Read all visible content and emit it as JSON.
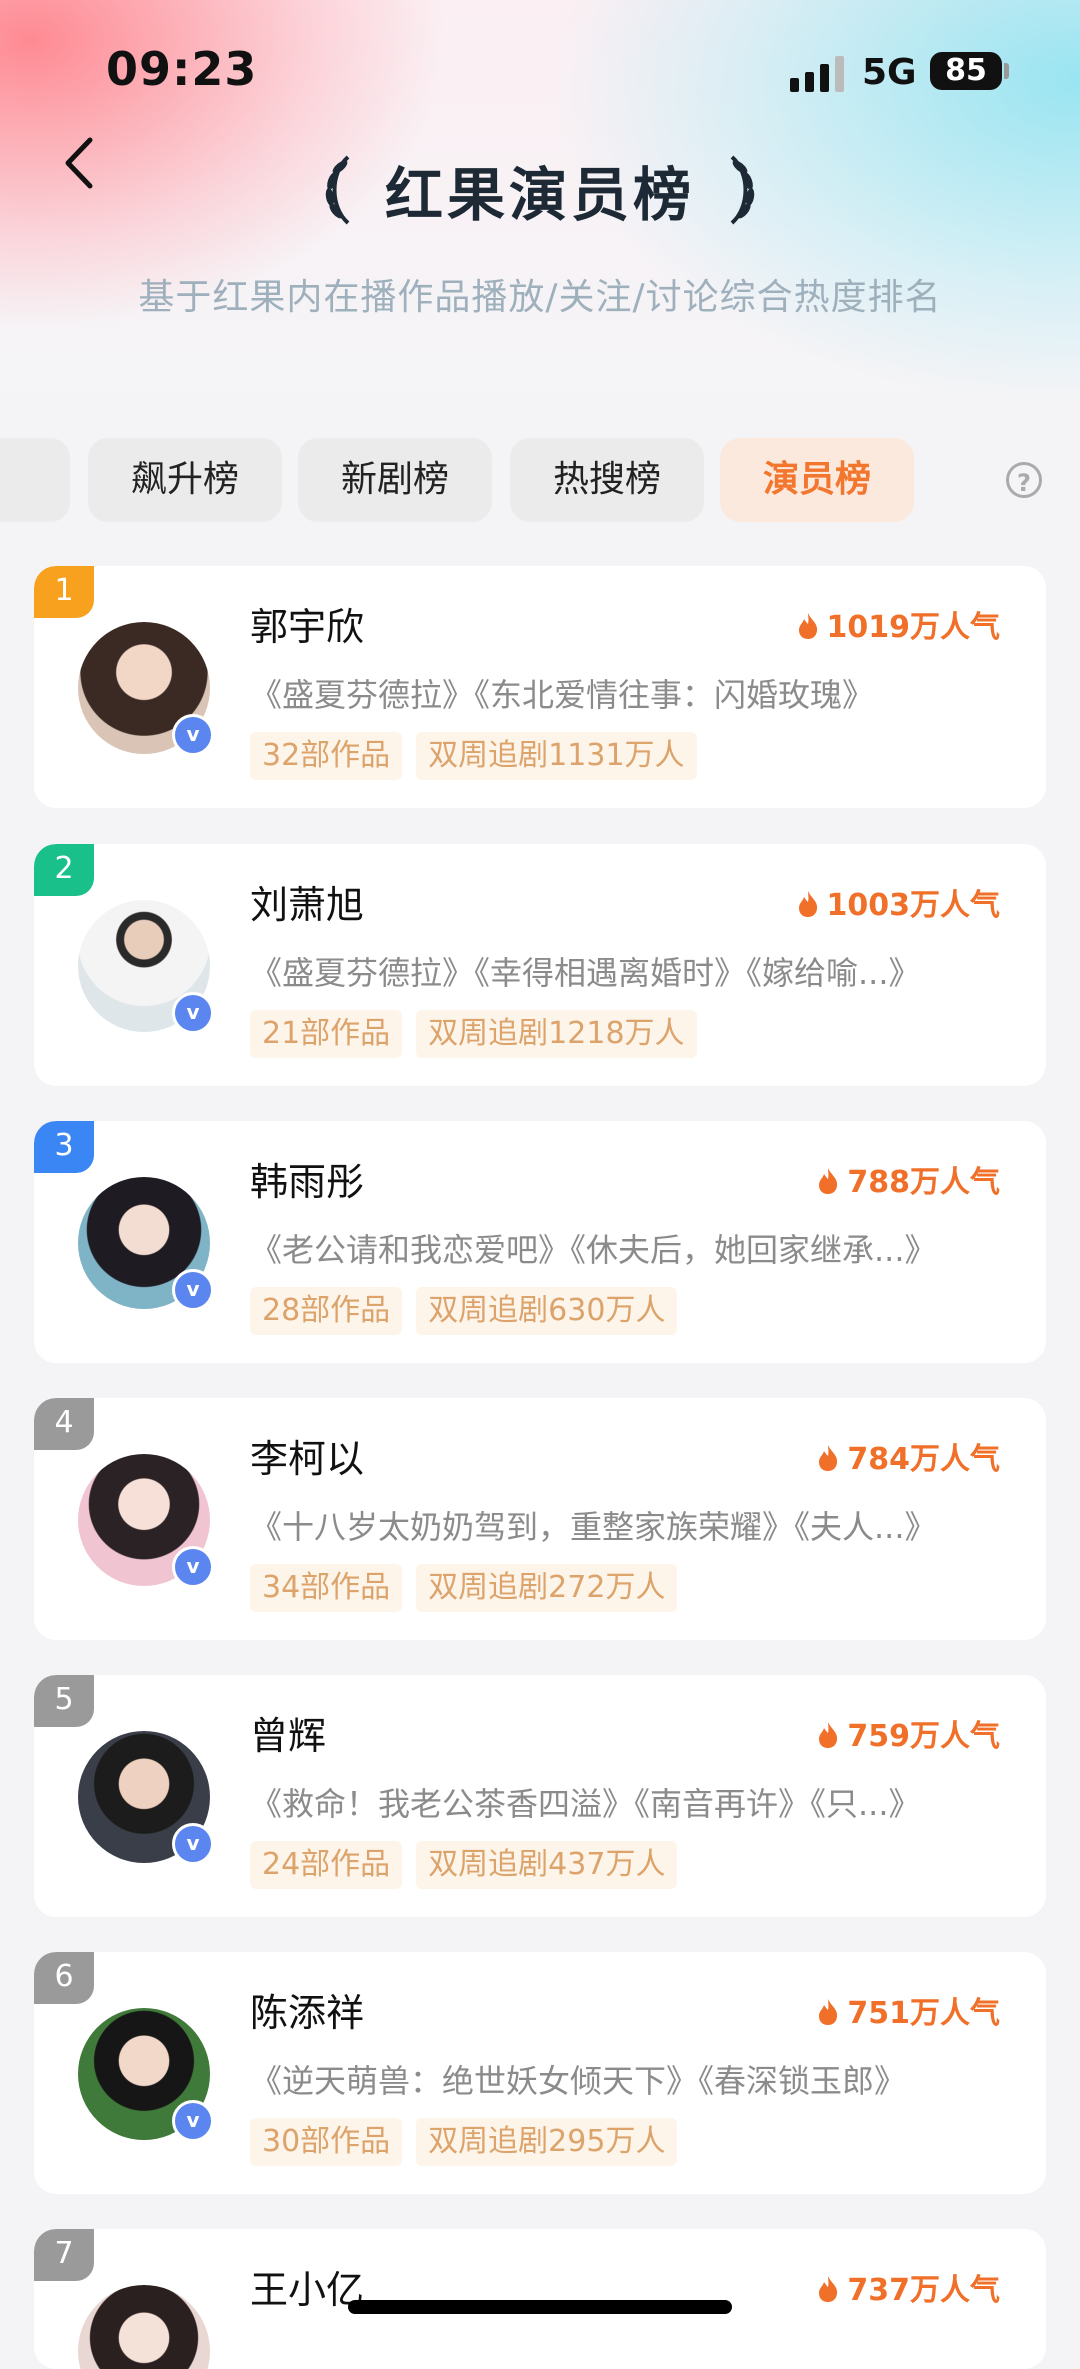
{
  "status_bar": {
    "time": "09:23",
    "network": "5G",
    "battery": "85"
  },
  "header": {
    "title": "红果演员榜",
    "subtitle": "基于红果内在播作品播放/关注/讨论综合热度排名"
  },
  "tabs": [
    {
      "label": "飙升榜",
      "active": false
    },
    {
      "label": "新剧榜",
      "active": false
    },
    {
      "label": "热搜榜",
      "active": false
    },
    {
      "label": "演员榜",
      "active": true
    }
  ],
  "colors": {
    "accent": "#f2762e",
    "rank_1": "#f7a11f",
    "rank_2": "#19c08a",
    "rank_3": "#3a86f5",
    "rank_other": "#9a9a9a",
    "tag_text": "#dca36b",
    "tag_bg": "#fdf4ea"
  },
  "actors": [
    {
      "rank": "1",
      "name": "郭宇欣",
      "popularity": "1019万人气",
      "works": "《盛夏芬德拉》《东北爱情往事：闪婚玫瑰》",
      "works_count": "32部作品",
      "followers": "双周追剧1131万人"
    },
    {
      "rank": "2",
      "name": "刘萧旭",
      "popularity": "1003万人气",
      "works": "《盛夏芬德拉》《幸得相遇离婚时》《嫁给喻...》",
      "works_count": "21部作品",
      "followers": "双周追剧1218万人"
    },
    {
      "rank": "3",
      "name": "韩雨彤",
      "popularity": "788万人气",
      "works": "《老公请和我恋爱吧》《休夫后，她回家继承...》",
      "works_count": "28部作品",
      "followers": "双周追剧630万人"
    },
    {
      "rank": "4",
      "name": "李柯以",
      "popularity": "784万人气",
      "works": "《十八岁太奶奶驾到，重整家族荣耀》《夫人...》",
      "works_count": "34部作品",
      "followers": "双周追剧272万人"
    },
    {
      "rank": "5",
      "name": "曾辉",
      "popularity": "759万人气",
      "works": "《救命！我老公茶香四溢》《南音再许》《只...》",
      "works_count": "24部作品",
      "followers": "双周追剧437万人"
    },
    {
      "rank": "6",
      "name": "陈添祥",
      "popularity": "751万人气",
      "works": "《逆天萌兽：绝世妖女倾天下》《春深锁玉郎》",
      "works_count": "30部作品",
      "followers": "双周追剧295万人"
    },
    {
      "rank": "7",
      "name": "王小亿",
      "popularity": "737万人气"
    }
  ]
}
